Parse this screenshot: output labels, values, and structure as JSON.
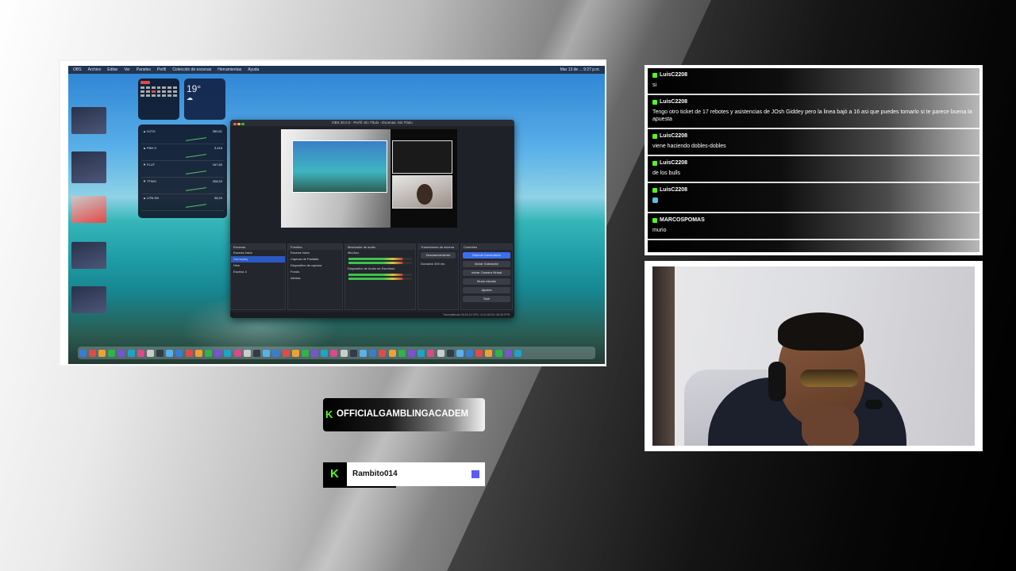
{
  "desktop": {
    "menubar": {
      "apps": [
        "OBS",
        "Archivo",
        "Editar",
        "Ver",
        "Paneles",
        "Perfil",
        "Colección de escenas",
        "Herramientas",
        "Ayuda"
      ],
      "clock": "Mar 13 de ... 9:27 p.m."
    },
    "widgets": {
      "weather_temp": "19°",
      "stocks": [
        {
          "symbol": "▲ DJT.K",
          "value": "350,51"
        },
        {
          "symbol": "▲ FNH.X",
          "value": "3,418"
        },
        {
          "symbol": "▼ FLUT",
          "value": "167,65"
        },
        {
          "symbol": "▼ TTWO",
          "value": "208,93"
        },
        {
          "symbol": "▲ UTN.SN",
          "value": "38,20"
        }
      ]
    },
    "obs": {
      "window_title": "OBS 30.0.0 - Perfil: Sin Título - Escenas: Sin Título",
      "docks": {
        "scenes": {
          "title": "Escenas",
          "items": [
            "Escena Inicio",
            "Gameplay",
            "Hive",
            "Escena 3"
          ]
        },
        "sources": {
          "title": "Fuentes",
          "items": [
            "Escena Inicio",
            "Captura de Pantalla",
            "Dispositivo de captura",
            "Fondo",
            "Alertas"
          ]
        },
        "mixer": {
          "title": "Mezclador de audio",
          "tracks": [
            "Mic/Aux",
            "Dispositivo de Audio de Escritorio"
          ]
        },
        "transitions": {
          "title": "Transiciones de escena",
          "value": "Desvanecimiento",
          "duration_label": "Duración",
          "duration": "300 ms"
        },
        "controls": {
          "title": "Controles",
          "buttons": [
            "Detener transmisión",
            "Iniciar Grabación",
            "Iniciar Cámara Virtual",
            "Modo estudio",
            "Ajustes",
            "Salir"
          ]
        }
      },
      "status": "Transmitiendo 00:52:14   CPU: 4.1%   60.00 / 60.00 FPS"
    }
  },
  "chat": {
    "accent": "#53fc18",
    "messages": [
      {
        "user": "LuisC2208",
        "text": "si"
      },
      {
        "user": "LuisC2208",
        "text": "Tengo otro ticket de 17 rebotes y asistencias de JOsh Giddey pero la linea bajó a 16 asi que puedes tomarlo si te parece buena la apuesta"
      },
      {
        "user": "LuisC2208",
        "text": "viene haciendo dobles-dobles"
      },
      {
        "user": "LuisC2208",
        "text": "de los bulls"
      },
      {
        "user": "LuisC2208",
        "text": "",
        "emoji": "emote"
      },
      {
        "user": "MARCOSPOMAS",
        "text": "murio"
      }
    ]
  },
  "banners": {
    "channel": "OFFICIALGAMBLINGACADEM",
    "channel_logo": "K",
    "follower": "Rambito014",
    "follower_logo": "K"
  }
}
